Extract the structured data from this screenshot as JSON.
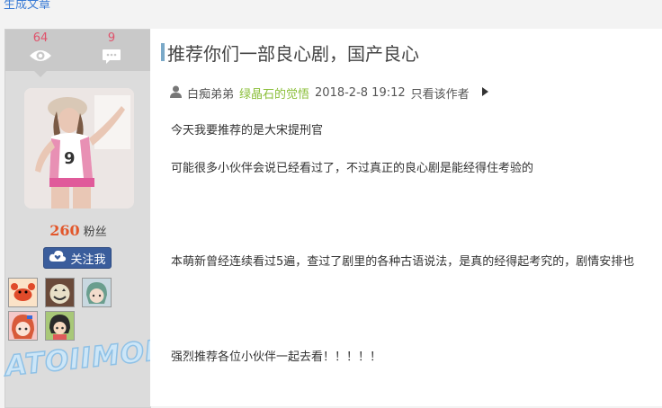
{
  "top_link": "生成文章",
  "sidebar": {
    "views_count": "64",
    "comments_count": "9",
    "fans_count": "260",
    "fans_label": "粉丝",
    "follow_label": "关注我",
    "fan_avatar_icons": [
      "crab-icon",
      "pumpkin-icon",
      "green-hair-icon",
      "anime-girl-icon",
      "black-hair-icon"
    ],
    "watermark": "ATOIIMOE"
  },
  "post": {
    "title": "推荐你们一部良心剧，国产良心",
    "author": "白痴弟弟",
    "group": "绿晶石的觉悟",
    "date": "2018-2-8 19:12",
    "author_only_label": "只看该作者",
    "paragraphs": [
      "今天我要推荐的是大宋提刑官",
      "可能很多小伙伴会说已经看过了，不过真正的良心剧是能经得住考验的",
      "本萌新曾经连续看过5遍，查过了剧里的各种古语说法，是真的经得起考究的，剧情安排也",
      "强烈推荐各位小伙伴一起去看！！！！！"
    ]
  },
  "colors": {
    "stat_number": "#e0526b",
    "fans_number": "#e2572b",
    "group_link": "#8bbf3a",
    "follow_button": "#3a5d9c",
    "title_accent": "#7aa9c8"
  }
}
